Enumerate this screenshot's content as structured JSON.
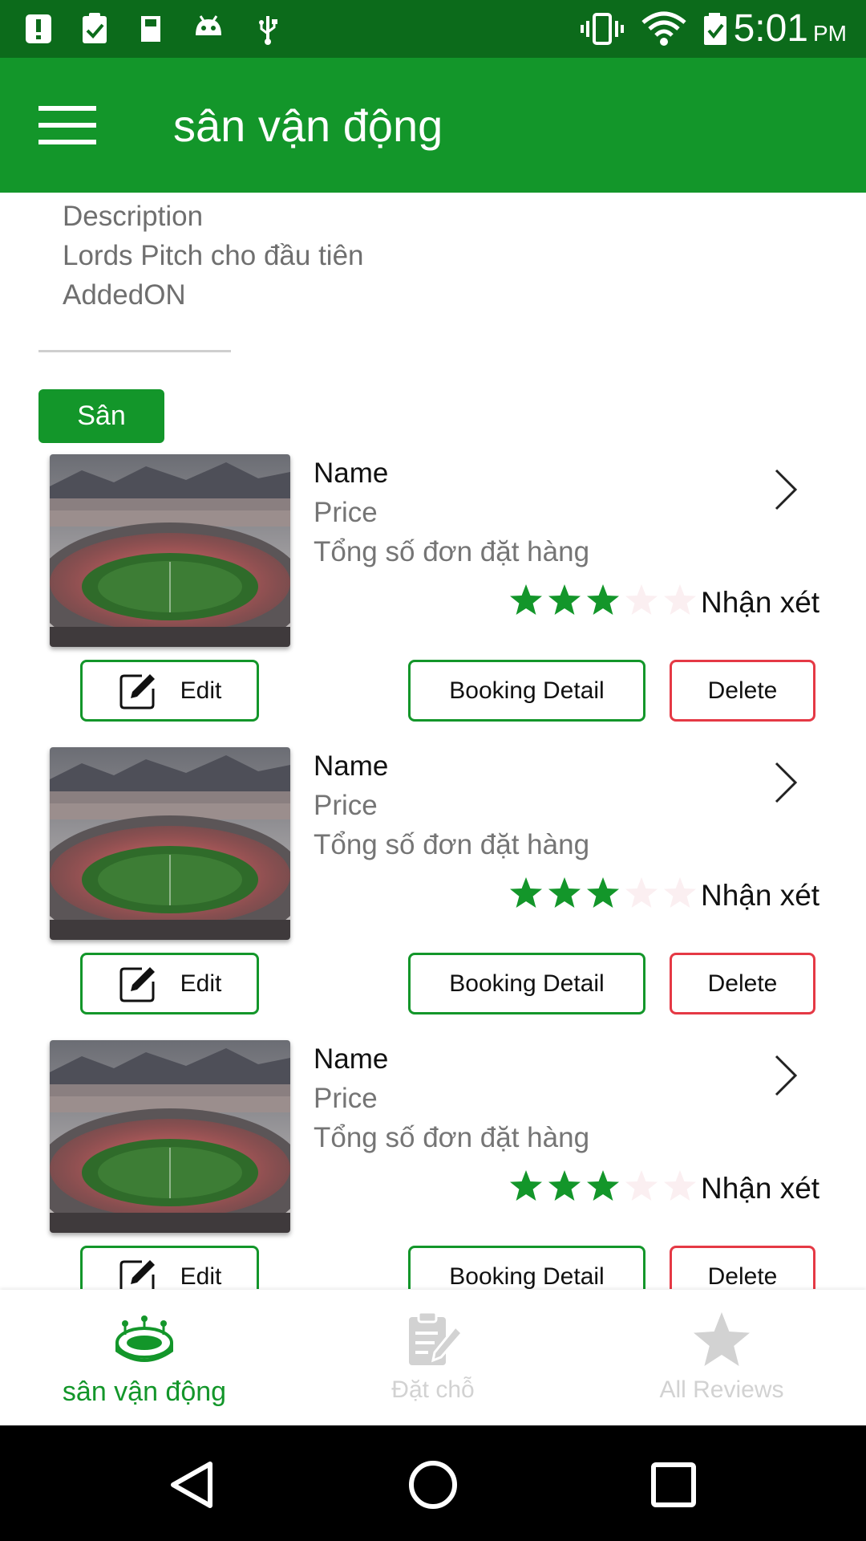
{
  "status_bar": {
    "time": "5:01",
    "ampm": "PM"
  },
  "app_bar": {
    "title": "sân vận động"
  },
  "description": {
    "label": "Description",
    "text": "Lords Pitch cho đầu tiên",
    "added_on": "AddedON"
  },
  "section_chip": "Sân",
  "stadiums": [
    {
      "name": "Name",
      "price": "Price",
      "orders_label": "Tổng số đơn đặt hàng",
      "rating": 3,
      "rating_max": 5,
      "review_label": "Nhận xét",
      "edit_label": "Edit",
      "booking_label": "Booking Detail",
      "delete_label": "Delete"
    },
    {
      "name": "Name",
      "price": "Price",
      "orders_label": "Tổng số đơn đặt hàng",
      "rating": 3,
      "rating_max": 5,
      "review_label": "Nhận xét",
      "edit_label": "Edit",
      "booking_label": "Booking Detail",
      "delete_label": "Delete"
    },
    {
      "name": "Name",
      "price": "Price",
      "orders_label": "Tổng số đơn đặt hàng",
      "rating": 3,
      "rating_max": 5,
      "review_label": "Nhận xét",
      "edit_label": "Edit",
      "booking_label": "Booking Detail",
      "delete_label": "Delete"
    }
  ],
  "bottom_nav": {
    "items": [
      {
        "label": "sân vận động",
        "icon": "stadium-icon",
        "active": true
      },
      {
        "label": "Đặt chỗ",
        "icon": "booking-clipboard-icon",
        "active": false
      },
      {
        "label": "All Reviews",
        "icon": "star-icon",
        "active": false
      }
    ]
  },
  "colors": {
    "status_bar": "#0c6b1b",
    "primary": "#13962a",
    "delete_border": "#e53945",
    "star_filled": "#13962a",
    "star_empty": "#fbeff1",
    "inactive_nav": "#d2d2d2"
  }
}
